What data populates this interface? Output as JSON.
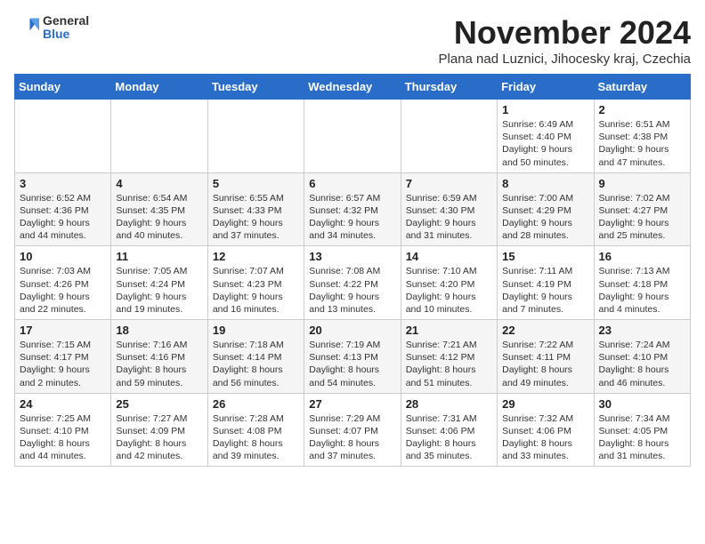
{
  "header": {
    "logo": {
      "general": "General",
      "blue": "Blue"
    },
    "month": "November 2024",
    "subtitle": "Plana nad Luznici, Jihocesky kraj, Czechia"
  },
  "days_of_week": [
    "Sunday",
    "Monday",
    "Tuesday",
    "Wednesday",
    "Thursday",
    "Friday",
    "Saturday"
  ],
  "weeks": [
    {
      "row_class": "row-odd",
      "days": [
        {
          "num": "",
          "info": ""
        },
        {
          "num": "",
          "info": ""
        },
        {
          "num": "",
          "info": ""
        },
        {
          "num": "",
          "info": ""
        },
        {
          "num": "",
          "info": ""
        },
        {
          "num": "1",
          "info": "Sunrise: 6:49 AM\nSunset: 4:40 PM\nDaylight: 9 hours\nand 50 minutes."
        },
        {
          "num": "2",
          "info": "Sunrise: 6:51 AM\nSunset: 4:38 PM\nDaylight: 9 hours\nand 47 minutes."
        }
      ]
    },
    {
      "row_class": "row-even",
      "days": [
        {
          "num": "3",
          "info": "Sunrise: 6:52 AM\nSunset: 4:36 PM\nDaylight: 9 hours\nand 44 minutes."
        },
        {
          "num": "4",
          "info": "Sunrise: 6:54 AM\nSunset: 4:35 PM\nDaylight: 9 hours\nand 40 minutes."
        },
        {
          "num": "5",
          "info": "Sunrise: 6:55 AM\nSunset: 4:33 PM\nDaylight: 9 hours\nand 37 minutes."
        },
        {
          "num": "6",
          "info": "Sunrise: 6:57 AM\nSunset: 4:32 PM\nDaylight: 9 hours\nand 34 minutes."
        },
        {
          "num": "7",
          "info": "Sunrise: 6:59 AM\nSunset: 4:30 PM\nDaylight: 9 hours\nand 31 minutes."
        },
        {
          "num": "8",
          "info": "Sunrise: 7:00 AM\nSunset: 4:29 PM\nDaylight: 9 hours\nand 28 minutes."
        },
        {
          "num": "9",
          "info": "Sunrise: 7:02 AM\nSunset: 4:27 PM\nDaylight: 9 hours\nand 25 minutes."
        }
      ]
    },
    {
      "row_class": "row-odd",
      "days": [
        {
          "num": "10",
          "info": "Sunrise: 7:03 AM\nSunset: 4:26 PM\nDaylight: 9 hours\nand 22 minutes."
        },
        {
          "num": "11",
          "info": "Sunrise: 7:05 AM\nSunset: 4:24 PM\nDaylight: 9 hours\nand 19 minutes."
        },
        {
          "num": "12",
          "info": "Sunrise: 7:07 AM\nSunset: 4:23 PM\nDaylight: 9 hours\nand 16 minutes."
        },
        {
          "num": "13",
          "info": "Sunrise: 7:08 AM\nSunset: 4:22 PM\nDaylight: 9 hours\nand 13 minutes."
        },
        {
          "num": "14",
          "info": "Sunrise: 7:10 AM\nSunset: 4:20 PM\nDaylight: 9 hours\nand 10 minutes."
        },
        {
          "num": "15",
          "info": "Sunrise: 7:11 AM\nSunset: 4:19 PM\nDaylight: 9 hours\nand 7 minutes."
        },
        {
          "num": "16",
          "info": "Sunrise: 7:13 AM\nSunset: 4:18 PM\nDaylight: 9 hours\nand 4 minutes."
        }
      ]
    },
    {
      "row_class": "row-even",
      "days": [
        {
          "num": "17",
          "info": "Sunrise: 7:15 AM\nSunset: 4:17 PM\nDaylight: 9 hours\nand 2 minutes."
        },
        {
          "num": "18",
          "info": "Sunrise: 7:16 AM\nSunset: 4:16 PM\nDaylight: 8 hours\nand 59 minutes."
        },
        {
          "num": "19",
          "info": "Sunrise: 7:18 AM\nSunset: 4:14 PM\nDaylight: 8 hours\nand 56 minutes."
        },
        {
          "num": "20",
          "info": "Sunrise: 7:19 AM\nSunset: 4:13 PM\nDaylight: 8 hours\nand 54 minutes."
        },
        {
          "num": "21",
          "info": "Sunrise: 7:21 AM\nSunset: 4:12 PM\nDaylight: 8 hours\nand 51 minutes."
        },
        {
          "num": "22",
          "info": "Sunrise: 7:22 AM\nSunset: 4:11 PM\nDaylight: 8 hours\nand 49 minutes."
        },
        {
          "num": "23",
          "info": "Sunrise: 7:24 AM\nSunset: 4:10 PM\nDaylight: 8 hours\nand 46 minutes."
        }
      ]
    },
    {
      "row_class": "row-odd",
      "days": [
        {
          "num": "24",
          "info": "Sunrise: 7:25 AM\nSunset: 4:10 PM\nDaylight: 8 hours\nand 44 minutes."
        },
        {
          "num": "25",
          "info": "Sunrise: 7:27 AM\nSunset: 4:09 PM\nDaylight: 8 hours\nand 42 minutes."
        },
        {
          "num": "26",
          "info": "Sunrise: 7:28 AM\nSunset: 4:08 PM\nDaylight: 8 hours\nand 39 minutes."
        },
        {
          "num": "27",
          "info": "Sunrise: 7:29 AM\nSunset: 4:07 PM\nDaylight: 8 hours\nand 37 minutes."
        },
        {
          "num": "28",
          "info": "Sunrise: 7:31 AM\nSunset: 4:06 PM\nDaylight: 8 hours\nand 35 minutes."
        },
        {
          "num": "29",
          "info": "Sunrise: 7:32 AM\nSunset: 4:06 PM\nDaylight: 8 hours\nand 33 minutes."
        },
        {
          "num": "30",
          "info": "Sunrise: 7:34 AM\nSunset: 4:05 PM\nDaylight: 8 hours\nand 31 minutes."
        }
      ]
    }
  ]
}
